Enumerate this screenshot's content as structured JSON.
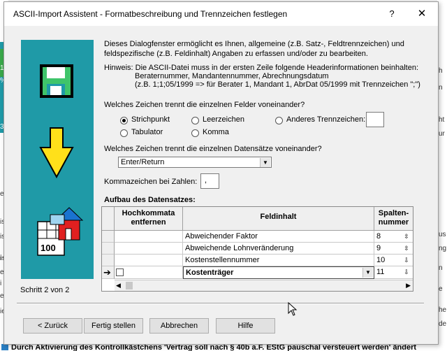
{
  "background": {
    "left_fragments": [
      "1.",
      "%",
      "3",
      "e",
      "is",
      "is",
      "isi",
      "e",
      "i",
      "e",
      "ie"
    ],
    "bottom_text": "Durch Aktivierung des Kontrollkästchens 'Vertrag soll nach § 40b a.F. EStG pauschal versteuert werden' ändert",
    "right_fragments": [
      "h",
      "n",
      "ht",
      "ur",
      "us",
      "ng",
      "n",
      "e",
      "he",
      "de"
    ]
  },
  "dialog": {
    "title": "ASCII-Import Assistent - Formatbeschreibung und Trennzeichen festlegen",
    "help_label": "?",
    "close_label": "✕",
    "intro_line1": "Dieses Dialogfenster ermöglicht es Ihnen, allgemeine (z.B. Satz-, Feldtrennzeichen) und",
    "intro_line2": "feldspezifische (z.B. Feldinhalt) Angaben zu erfassen und/oder zu bearbeiten.",
    "hint_line1": "Hinweis: Die ASCII-Datei muss in der ersten Zeile folgende Headerinformationen beinhalten:",
    "hint_line2": "Beraternummer, Mandantennummer, Abrechnungsdatum",
    "hint_line3": "(z.B. 1;1;05/1999   => für Berater 1, Mandant 1, AbrDat 05/1999 mit Trennzeichen \";\")",
    "field_sep_question": "Welches Zeichen trennt die einzelnen Felder voneinander?",
    "field_sep_options": {
      "semicolon": "Strichpunkt",
      "space": "Leerzeichen",
      "other": "Anderes Trennzeichen:",
      "tab": "Tabulator",
      "comma": "Komma"
    },
    "record_sep_question": "Welches Zeichen trennt die einzelnen Datensätze voneinander?",
    "record_sep_value": "Enter/Return",
    "decimal_label": "Kommazeichen bei Zahlen:",
    "decimal_value": ",",
    "structure_heading": "Aufbau des Datensatzes:",
    "grid": {
      "columns": [
        "Hochkommata entfernen",
        "Feldinhalt",
        "Spalten-nummer"
      ],
      "rows": [
        {
          "field": "Abweichender Faktor",
          "col": "8"
        },
        {
          "field": "Abweichende Lohnveränderung",
          "col": "9"
        },
        {
          "field": "Kostenstellennummer",
          "col": "10"
        },
        {
          "field": "Kostenträger",
          "col": "11"
        }
      ]
    },
    "step_label": "Schritt 2 von 2",
    "buttons": {
      "back": "< Zurück",
      "finish": "Fertig stellen",
      "cancel": "Abbrechen",
      "help": "Hilfe"
    }
  }
}
